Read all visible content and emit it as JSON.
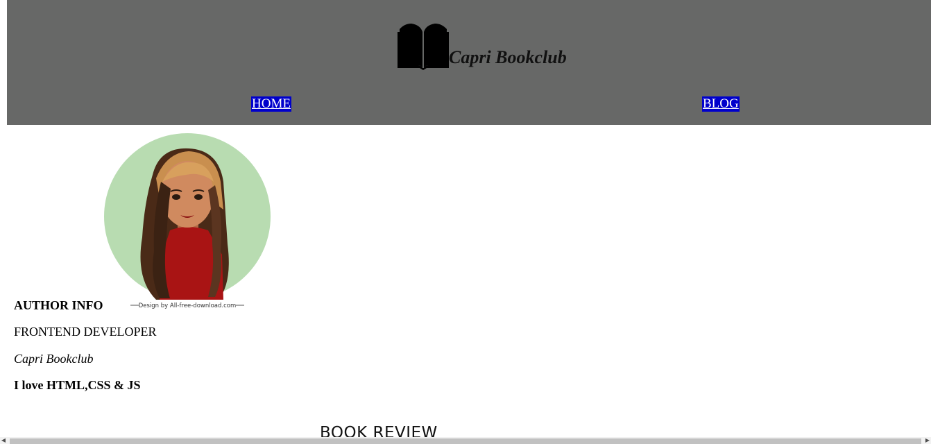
{
  "header": {
    "brand_title": "Capri Bookclub",
    "brand_icon": "open-book-icon",
    "background_color": "#676867"
  },
  "nav": {
    "items": [
      {
        "label": "HOME"
      },
      {
        "label": "BLOG"
      }
    ],
    "link_background": "#0000cc",
    "link_color": "#ffffff"
  },
  "author": {
    "avatar_credit": "Design by All-free-download.com",
    "heading": "AUTHOR INFO",
    "role": "FRONTEND DEVELOPER",
    "club": "Capri Bookclub",
    "tagline": "I love HTML,CSS & JS"
  },
  "main": {
    "section_heading": "BOOK REVIEW"
  },
  "scrollbar": {
    "left_arrow_icon": "chevron-left-icon",
    "right_arrow_icon": "chevron-right-icon"
  }
}
